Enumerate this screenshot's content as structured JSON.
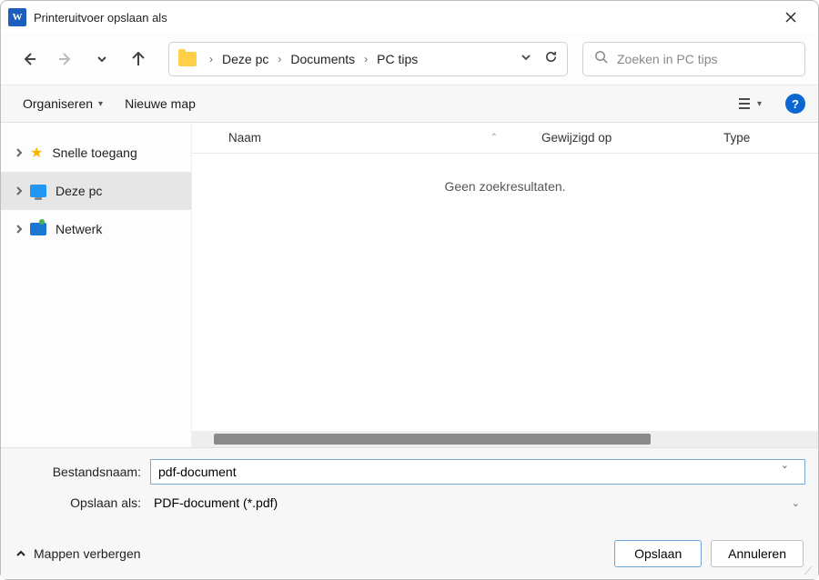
{
  "window": {
    "title": "Printeruitvoer opslaan als"
  },
  "breadcrumb": {
    "items": [
      "Deze pc",
      "Documents",
      "PC tips"
    ]
  },
  "search": {
    "placeholder": "Zoeken in PC tips"
  },
  "toolbar": {
    "organize": "Organiseren",
    "new_folder": "Nieuwe map"
  },
  "tree": {
    "quick_access": "Snelle toegang",
    "this_pc": "Deze pc",
    "network": "Netwerk"
  },
  "columns": {
    "name": "Naam",
    "modified": "Gewijzigd op",
    "type": "Type"
  },
  "results": {
    "empty": "Geen zoekresultaten."
  },
  "fields": {
    "filename_label": "Bestandsnaam:",
    "filename_value": "pdf-document",
    "saveas_label": "Opslaan als:",
    "saveas_value": "PDF-document (*.pdf)"
  },
  "actions": {
    "hide_folders": "Mappen verbergen",
    "save": "Opslaan",
    "cancel": "Annuleren"
  },
  "help": {
    "label": "?"
  }
}
